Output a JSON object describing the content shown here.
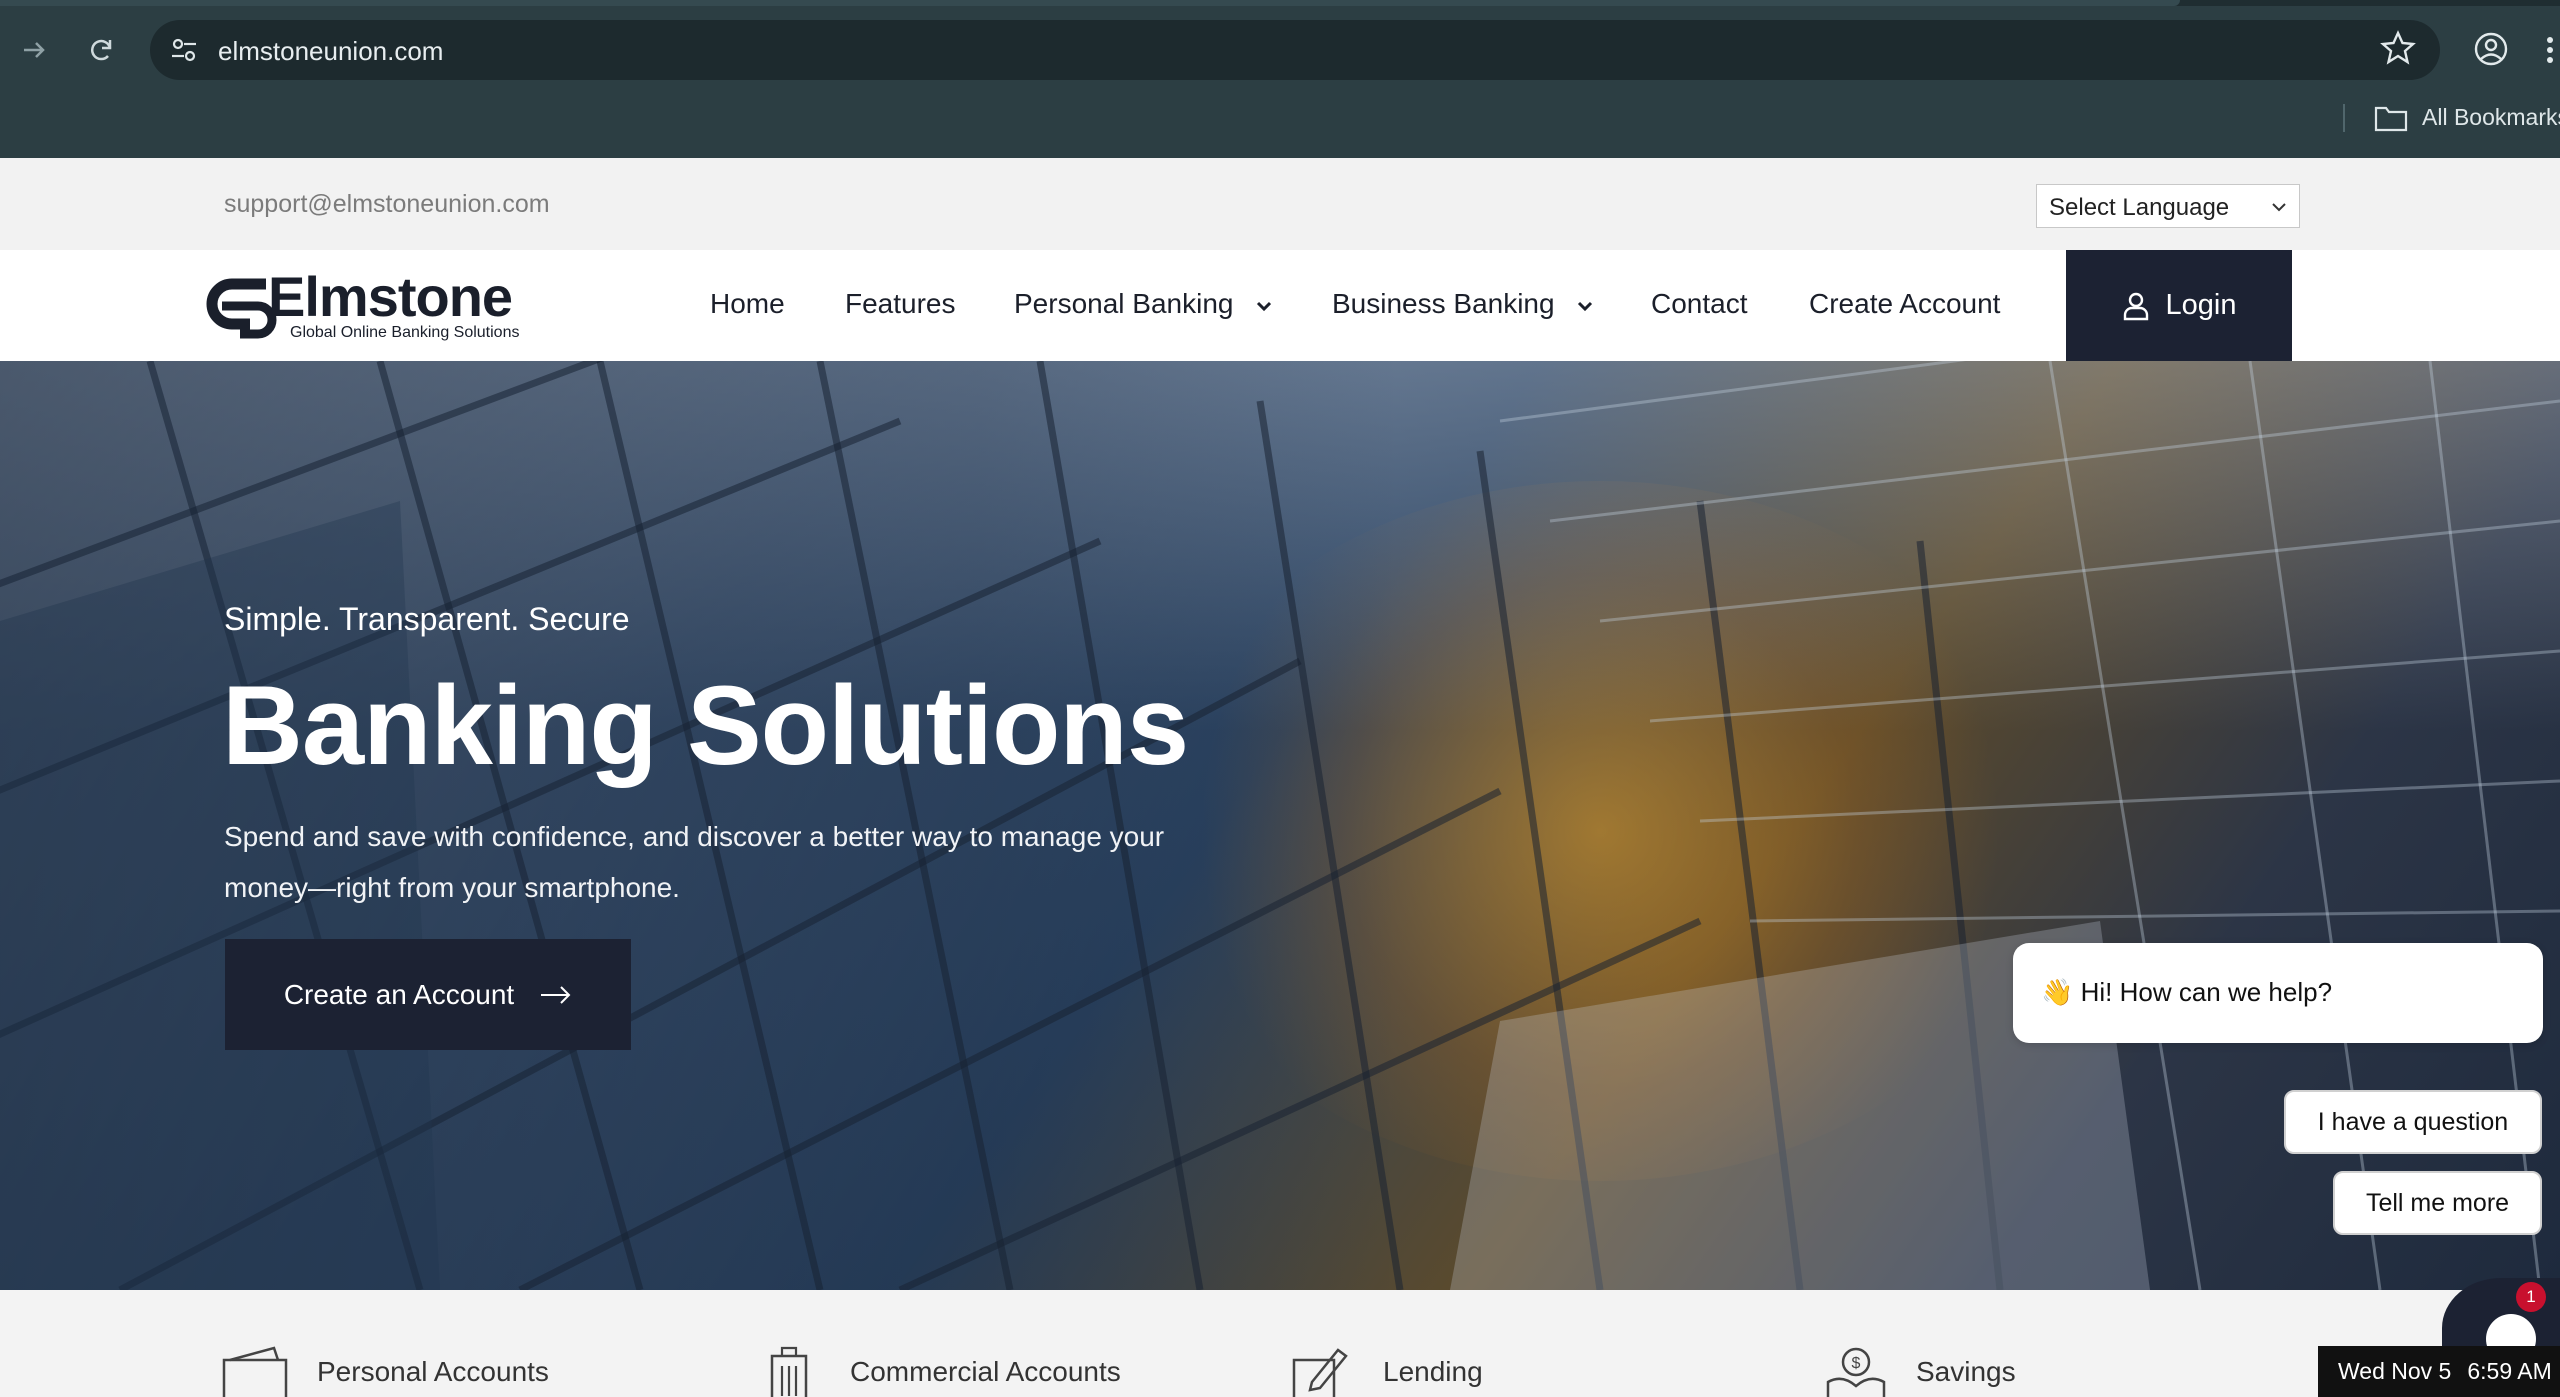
{
  "browser": {
    "url": "elmstoneunion.com",
    "bookmarks_label": "All Bookmarks"
  },
  "topbar": {
    "support_email": "support@elmstoneunion.com",
    "language_select": "Select Language"
  },
  "nav": {
    "logo_word": "Elmstone",
    "logo_tagline": "Global Online Banking Solutions",
    "items": [
      {
        "label": "Home"
      },
      {
        "label": "Features"
      },
      {
        "label": "Personal Banking"
      },
      {
        "label": "Business Banking"
      },
      {
        "label": "Contact"
      },
      {
        "label": "Create Account"
      }
    ],
    "login_label": "Login"
  },
  "hero": {
    "eyebrow": "Simple. Transparent. Secure",
    "title": "Banking Solutions",
    "text": "Spend and save with confidence, and discover a better way to manage your money—right from your smartphone.",
    "cta_label": "Create an Account"
  },
  "chat": {
    "greeting": "👋 Hi! How can we help?",
    "options": [
      "I have a question",
      "Tell me more"
    ],
    "badge_count": "1"
  },
  "features": [
    {
      "label": "Personal Accounts",
      "icon": "wallet-icon"
    },
    {
      "label": "Commercial Accounts",
      "icon": "building-icon"
    },
    {
      "label": "Lending",
      "icon": "pen-icon"
    },
    {
      "label": "Savings",
      "icon": "money-bag-icon"
    }
  ],
  "clock": {
    "date": "Wed Nov 5",
    "time": "6:59 AM"
  }
}
